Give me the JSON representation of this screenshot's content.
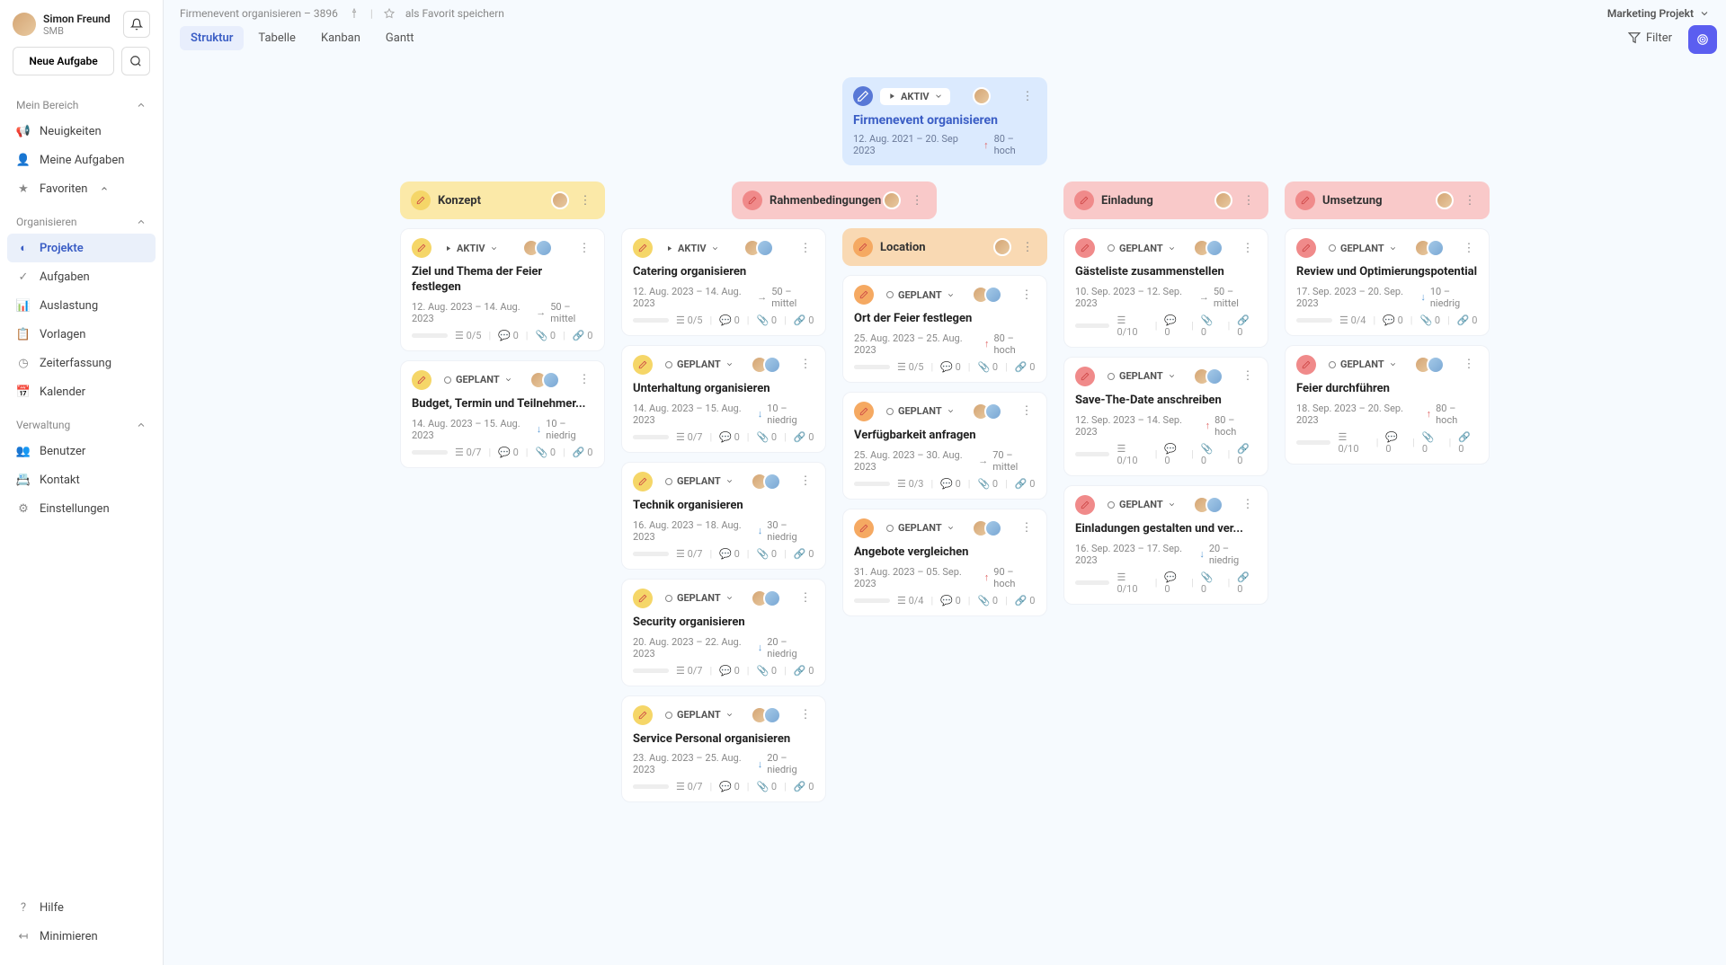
{
  "user": {
    "name": "Simon Freund",
    "sub": "SMB"
  },
  "sidebar": {
    "new_task": "Neue Aufgabe",
    "sections": [
      {
        "label": "Mein Bereich",
        "items": [
          {
            "icon": "megaphone",
            "label": "Neuigkeiten"
          },
          {
            "icon": "user",
            "label": "Meine Aufgaben"
          },
          {
            "icon": "star",
            "label": "Favoriten",
            "chev": true
          }
        ]
      },
      {
        "label": "Organisieren",
        "items": [
          {
            "icon": "pie",
            "label": "Projekte",
            "active": true
          },
          {
            "icon": "check",
            "label": "Aufgaben"
          },
          {
            "icon": "chart",
            "label": "Auslastung"
          },
          {
            "icon": "template",
            "label": "Vorlagen"
          },
          {
            "icon": "clock",
            "label": "Zeiterfassung"
          },
          {
            "icon": "calendar",
            "label": "Kalender"
          }
        ]
      },
      {
        "label": "Verwaltung",
        "items": [
          {
            "icon": "users",
            "label": "Benutzer"
          },
          {
            "icon": "contact",
            "label": "Kontakt"
          },
          {
            "icon": "gear",
            "label": "Einstellungen"
          }
        ]
      }
    ],
    "bottom": [
      {
        "icon": "help",
        "label": "Hilfe"
      },
      {
        "icon": "collapse",
        "label": "Minimieren"
      }
    ]
  },
  "breadcrumb": {
    "path": "Firmenevent organisieren – 3896",
    "fav": "als Favorit speichern"
  },
  "project_selector": "Marketing Projekt",
  "tabs": [
    "Struktur",
    "Tabelle",
    "Kanban",
    "Gantt"
  ],
  "filter": "Filter",
  "root": {
    "status": "AKTIV",
    "title": "Firmenevent organisieren",
    "dates": "12. Aug. 2021 – 20. Sep 2023",
    "priority": "80 – hoch"
  },
  "cols": [
    {
      "color": "yellow",
      "edit": "ec-yellow",
      "title": "Konzept",
      "tasks": [
        {
          "status": "AKTIV",
          "play": true,
          "title": "Ziel und Thema der Feier festlegen",
          "dates": "12. Aug. 2023 – 14. Aug. 2023",
          "arrow": "right",
          "priority": "50 – mittel",
          "prog": "0/5",
          "c": "0",
          "a": "0",
          "l": "0"
        },
        {
          "status": "GEPLANT",
          "title": "Budget, Termin und Teilnehmer...",
          "dates": "14. Aug. 2023 – 15. Aug. 2023",
          "arrow": "down",
          "priority": "10 – niedrig",
          "prog": "0/7",
          "c": "0",
          "a": "0",
          "l": "0"
        }
      ]
    },
    {
      "color": "red",
      "edit": "ec-red",
      "title": "Rahmenbedingungen",
      "sub": [
        {
          "tasks": [
            {
              "status": "AKTIV",
              "play": true,
              "edit": "ec-yellow",
              "title": "Catering organisieren",
              "dates": "12. Aug. 2023 – 14. Aug. 2023",
              "arrow": "right",
              "priority": "50 – mittel",
              "prog": "0/5",
              "c": "0",
              "a": "0",
              "l": "0"
            },
            {
              "status": "GEPLANT",
              "edit": "ec-yellow",
              "title": "Unterhaltung organisieren",
              "dates": "14. Aug. 2023 – 15. Aug. 2023",
              "arrow": "down",
              "priority": "10 – niedrig",
              "prog": "0/7",
              "c": "0",
              "a": "0",
              "l": "0"
            },
            {
              "status": "GEPLANT",
              "edit": "ec-yellow",
              "title": "Technik organisieren",
              "dates": "16. Aug. 2023 – 18. Aug. 2023",
              "arrow": "down",
              "priority": "30 – niedrig",
              "prog": "0/7",
              "c": "0",
              "a": "0",
              "l": "0"
            },
            {
              "status": "GEPLANT",
              "edit": "ec-yellow",
              "title": "Security organisieren",
              "dates": "20. Aug. 2023 – 22. Aug. 2023",
              "arrow": "down",
              "priority": "20 – niedrig",
              "prog": "0/7",
              "c": "0",
              "a": "0",
              "l": "0"
            },
            {
              "status": "GEPLANT",
              "edit": "ec-yellow",
              "title": "Service Personal organisieren",
              "dates": "23. Aug. 2023 – 25. Aug. 2023",
              "arrow": "down",
              "priority": "20 – niedrig",
              "prog": "0/7",
              "c": "0",
              "a": "0",
              "l": "0"
            }
          ]
        },
        {
          "header": {
            "color": "orange",
            "edit": "ec-orange",
            "title": "Location"
          },
          "tasks": [
            {
              "status": "GEPLANT",
              "edit": "ec-orange",
              "title": "Ort der Feier festlegen",
              "dates": "25. Aug. 2023 – 25. Aug. 2023",
              "arrow": "up",
              "priority": "80 – hoch",
              "prog": "0/5",
              "c": "0",
              "a": "0",
              "l": "0"
            },
            {
              "status": "GEPLANT",
              "edit": "ec-orange",
              "title": "Verfügbarkeit anfragen",
              "dates": "25. Aug. 2023 – 30. Aug. 2023",
              "arrow": "right",
              "priority": "70 – mittel",
              "prog": "0/3",
              "c": "0",
              "a": "0",
              "l": "0"
            },
            {
              "status": "GEPLANT",
              "edit": "ec-orange",
              "title": "Angebote vergleichen",
              "dates": "31. Aug. 2023 – 05. Sep. 2023",
              "arrow": "up",
              "priority": "90 – hoch",
              "prog": "0/4",
              "c": "0",
              "a": "0",
              "l": "0"
            }
          ]
        }
      ]
    },
    {
      "color": "red",
      "edit": "ec-red",
      "title": "Einladung",
      "tasks": [
        {
          "status": "GEPLANT",
          "edit": "ec-red",
          "title": "Gästeliste zusammenstellen",
          "dates": "10. Sep. 2023 – 12. Sep. 2023",
          "arrow": "right",
          "priority": "50 – mittel",
          "prog": "0/10",
          "c": "0",
          "a": "0",
          "l": "0"
        },
        {
          "status": "GEPLANT",
          "edit": "ec-red",
          "title": "Save-The-Date anschreiben",
          "dates": "12. Sep. 2023 – 14. Sep. 2023",
          "arrow": "up",
          "priority": "80 – hoch",
          "prog": "0/10",
          "c": "0",
          "a": "0",
          "l": "0"
        },
        {
          "status": "GEPLANT",
          "edit": "ec-red",
          "title": "Einladungen gestalten und ver...",
          "dates": "16. Sep. 2023 – 17. Sep. 2023",
          "arrow": "down",
          "priority": "20 – niedrig",
          "prog": "0/10",
          "c": "0",
          "a": "0",
          "l": "0"
        }
      ]
    },
    {
      "color": "red",
      "edit": "ec-red",
      "title": "Umsetzung",
      "tasks": [
        {
          "status": "GEPLANT",
          "edit": "ec-red",
          "title": "Review und Optimierungspotential",
          "dates": "17. Sep. 2023 – 20. Sep. 2023",
          "arrow": "down",
          "priority": "10 – niedrig",
          "prog": "0/4",
          "c": "0",
          "a": "0",
          "l": "0"
        },
        {
          "status": "GEPLANT",
          "edit": "ec-red",
          "title": "Feier durchführen",
          "dates": "18. Sep. 2023 – 20. Sep. 2023",
          "arrow": "up",
          "priority": "80 – hoch",
          "prog": "0/10",
          "c": "0",
          "a": "0",
          "l": "0"
        }
      ]
    }
  ]
}
